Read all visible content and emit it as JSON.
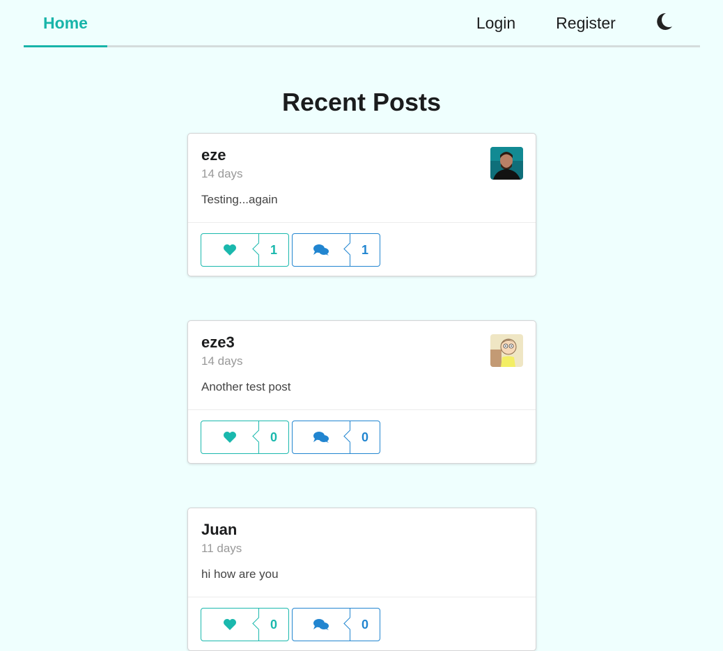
{
  "nav": {
    "home": "Home",
    "login": "Login",
    "register": "Register",
    "theme_icon": "moon-icon"
  },
  "page_title": "Recent Posts",
  "colors": {
    "background": "#effffe",
    "accent": "#18b4a9",
    "like": "#1ab8ad",
    "comment": "#2185d0"
  },
  "posts": [
    {
      "username": "eze",
      "time": "14 days",
      "body": "Testing...again",
      "likes": "1",
      "comments": "1",
      "avatar": "photo-avatar"
    },
    {
      "username": "eze3",
      "time": "14 days",
      "body": "Another test post",
      "likes": "0",
      "comments": "0",
      "avatar": "cartoon-avatar"
    },
    {
      "username": "Juan",
      "time": "11 days",
      "body": "hi how are you",
      "likes": "0",
      "comments": "0",
      "avatar": ""
    }
  ]
}
